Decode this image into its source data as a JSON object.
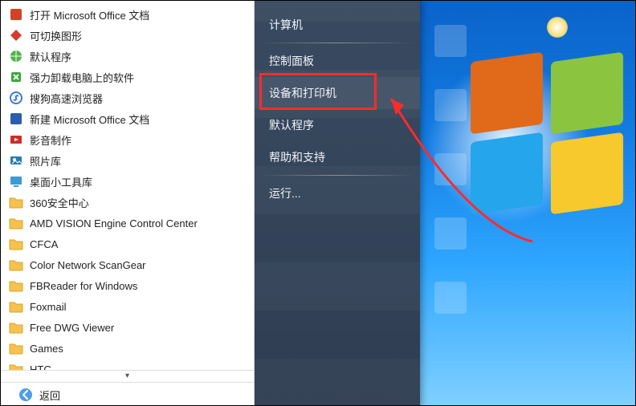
{
  "left": {
    "programs": [
      {
        "name": "open-office-doc",
        "icon": "office",
        "label": "打开 Microsoft Office 文档"
      },
      {
        "name": "switch-graphics",
        "icon": "switch",
        "label": "可切换图形"
      },
      {
        "name": "default-programs",
        "icon": "globe",
        "label": "默认程序"
      },
      {
        "name": "uninstall",
        "icon": "uninstall",
        "label": "强力卸载电脑上的软件"
      },
      {
        "name": "sogou-browser",
        "icon": "sogou",
        "label": "搜狗高速浏览器"
      },
      {
        "name": "new-office-doc",
        "icon": "new-office",
        "label": "新建 Microsoft Office 文档"
      },
      {
        "name": "movie-maker",
        "icon": "movie",
        "label": "影音制作"
      },
      {
        "name": "photo-gallery",
        "icon": "photo",
        "label": "照片库"
      },
      {
        "name": "desktop-gadgets",
        "icon": "gadget",
        "label": "桌面小工具库"
      },
      {
        "name": "360-safe",
        "icon": "folder",
        "label": "360安全中心"
      },
      {
        "name": "amd-vision",
        "icon": "folder",
        "label": "AMD VISION Engine Control Center"
      },
      {
        "name": "cfca",
        "icon": "folder",
        "label": "CFCA"
      },
      {
        "name": "color-scangear",
        "icon": "folder",
        "label": "Color Network ScanGear"
      },
      {
        "name": "fbreader",
        "icon": "folder",
        "label": "FBReader for Windows"
      },
      {
        "name": "foxmail",
        "icon": "folder",
        "label": "Foxmail"
      },
      {
        "name": "free-dwg",
        "icon": "folder",
        "label": "Free DWG Viewer"
      },
      {
        "name": "games",
        "icon": "folder",
        "label": "Games"
      },
      {
        "name": "htc",
        "icon": "folder",
        "label": "HTC"
      }
    ],
    "back_label": "返回"
  },
  "right": {
    "items": [
      {
        "name": "computer",
        "label": "计算机",
        "sep": true
      },
      {
        "name": "control-panel",
        "label": "控制面板"
      },
      {
        "name": "devices-printers",
        "label": "设备和打印机",
        "highlighted": true
      },
      {
        "name": "default-programs",
        "label": "默认程序"
      },
      {
        "name": "help-support",
        "label": "帮助和支持"
      },
      {
        "name": "run",
        "label": "运行...",
        "sep_before": true
      }
    ]
  },
  "annotation": {
    "highlight_target": "devices-printers",
    "color": "#ff2b2b"
  }
}
